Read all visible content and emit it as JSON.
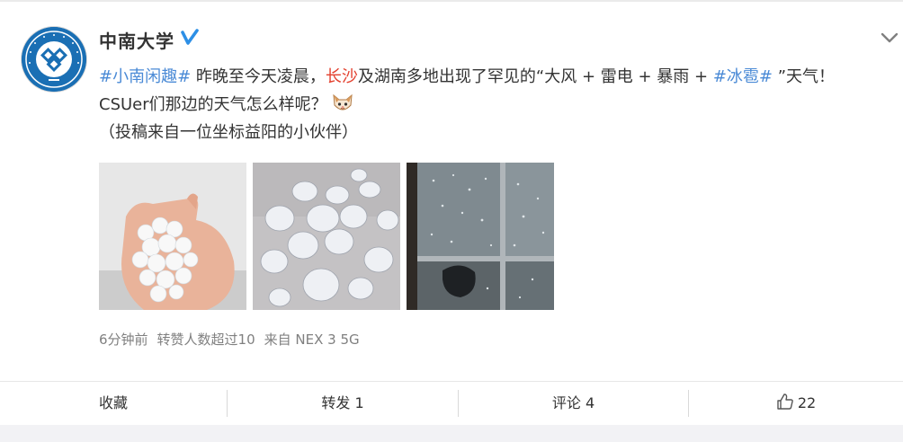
{
  "post": {
    "author": "中南大学",
    "topic1": "#小南闲趣#",
    "text_a": " 昨晚至今天凌晨，",
    "place": "长沙",
    "text_b": "及湖南多地出现了罕见的“大风 + 雷电 + 暴雨 + ",
    "topic2": "#冰雹#",
    "text_c": " ”天气！CSUer们那边的天气怎么样呢？",
    "text_d": "（投稿来自一位坐标益阳的小伙伴）",
    "emoji": "cat-face-emoji"
  },
  "meta": {
    "time": "6分钟前",
    "reposts": "转赞人数超过10",
    "source": "来自 NEX 3 5G"
  },
  "actions": {
    "collect": "收藏",
    "forward": "转发 1",
    "comment": "评论 4",
    "like": "22"
  },
  "colors": {
    "topic": "#4a8ad6",
    "highlight": "#e3412f",
    "brand": "#1a6fb4",
    "verified": "#2d8fe6"
  }
}
